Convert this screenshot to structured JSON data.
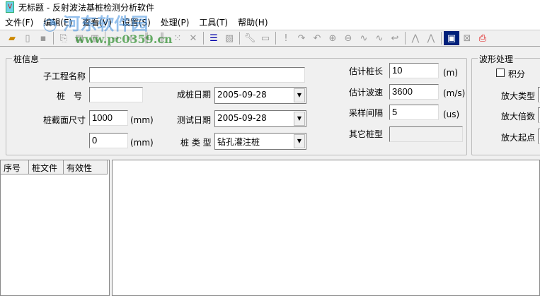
{
  "window": {
    "title": "无标题 - 反射波法基桩检测分析软件"
  },
  "menu": [
    "文件(F)",
    "编辑(E)",
    "查看(V)",
    "设置(S)",
    "处理(P)",
    "工具(T)",
    "帮助(H)"
  ],
  "watermark": {
    "name": "河东软件园",
    "url": "www.pc0359.cn"
  },
  "pile_info": {
    "legend": "桩信息",
    "subproject_label": "子工程名称",
    "subproject_value": "",
    "pile_no_label": "桩　号",
    "pile_no_value": "",
    "section_label": "桩截面尺寸",
    "section_value1": "1000",
    "section_value2": "0",
    "unit_mm": "(mm)",
    "build_date_label": "成桩日期",
    "build_date": "2005-09-28",
    "test_date_label": "测试日期",
    "test_date": "2005-09-28",
    "pile_type_label": "桩 类 型",
    "pile_type": "钻孔灌注桩",
    "est_length_label": "估计桩长",
    "est_length": "10",
    "unit_m": "(m)",
    "est_speed_label": "估计波速",
    "est_speed": "3600",
    "unit_ms": "(m/s)",
    "interval_label": "采样间隔",
    "interval": "5",
    "unit_us": "(us)",
    "other_label": "其它桩型",
    "other_value": ""
  },
  "wave": {
    "legend": "波形处理",
    "integral_label": "积分",
    "amp_type_label": "放大类型",
    "amp_factor_label": "放大倍数",
    "amp_start_label": "放大起点"
  },
  "list": {
    "columns": [
      "序号",
      "桩文件",
      "有效性"
    ]
  }
}
